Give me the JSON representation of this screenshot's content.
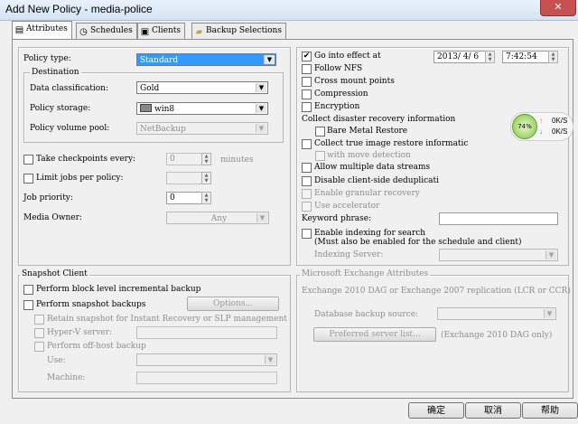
{
  "window": {
    "title": "Add New Policy - media-police",
    "close_glyph": "✕"
  },
  "tabs": [
    {
      "label": "Attributes",
      "icon": "attributes-icon"
    },
    {
      "label": "Schedules",
      "icon": "schedules-icon"
    },
    {
      "label": "Clients",
      "icon": "clients-icon"
    },
    {
      "label": "Backup Selections",
      "icon": "folder-icon"
    }
  ],
  "left": {
    "policy_type_label": "Policy type:",
    "policy_type_value": "Standard",
    "destination_legend": "Destination",
    "data_classification_label": "Data classification:",
    "data_classification_value": "Gold",
    "policy_storage_label": "Policy storage:",
    "policy_storage_value": "win8",
    "policy_volume_pool_label": "Policy volume pool:",
    "policy_volume_pool_value": "NetBackup",
    "take_checkpoints_label": "Take checkpoints every:",
    "take_checkpoints_value": "0",
    "minutes_label": "minutes",
    "limit_jobs_label": "Limit jobs per policy:",
    "limit_jobs_value": "",
    "job_priority_label": "Job priority:",
    "job_priority_value": "0",
    "media_owner_label": "Media Owner:",
    "media_owner_value": "Any"
  },
  "right": {
    "go_into_effect_label": "Go into effect at",
    "go_into_effect_checked": "✔",
    "date_value": "2013/ 4/ 6",
    "time_value": "7:42:54",
    "follow_nfs_label": "Follow NFS",
    "cross_mount_label": "Cross mount points",
    "compression_label": "Compression",
    "encryption_label": "Encryption",
    "collect_dr_label": "Collect disaster recovery information",
    "bare_metal_label": "Bare Metal Restore",
    "collect_tir_label": "Collect true image restore informatic",
    "with_move_label": "with move detection",
    "allow_multiple_label": "Allow multiple data streams",
    "disable_dedup_label": "Disable client-side deduplicati",
    "enable_granular_label": "Enable granular recovery",
    "use_accelerator_label": "Use accelerator",
    "keyword_label": "Keyword phrase:",
    "keyword_value": "",
    "enable_indexing_label": "Enable indexing for search",
    "enable_indexing_note": "(Must also be enabled for the schedule and client)",
    "indexing_server_label": "Indexing Server:"
  },
  "network_widget": {
    "percent": "74%",
    "up": "0K/S",
    "down": "0K/S"
  },
  "snapshot": {
    "legend": "Snapshot Client",
    "block_level_label": "Perform block level incremental backup",
    "snapshot_backups_label": "Perform snapshot backups",
    "options_button": "Options...",
    "retain_label": "Retain snapshot for Instant Recovery or SLP management",
    "hyperv_label": "Hyper-V server:",
    "offhost_label": "Perform off-host backup",
    "use_label": "Use:",
    "machine_label": "Machine:"
  },
  "exchange": {
    "legend": "Microsoft Exchange Attributes",
    "dag_label": "Exchange 2010 DAG or Exchange 2007 replication (LCR or CCR)",
    "db_source_label": "Database backup source:",
    "preferred_button": "Preferred server list...",
    "preferred_note": "(Exchange 2010 DAG only)"
  },
  "footer": {
    "ok": "确定",
    "cancel": "取消",
    "help": "帮助"
  }
}
